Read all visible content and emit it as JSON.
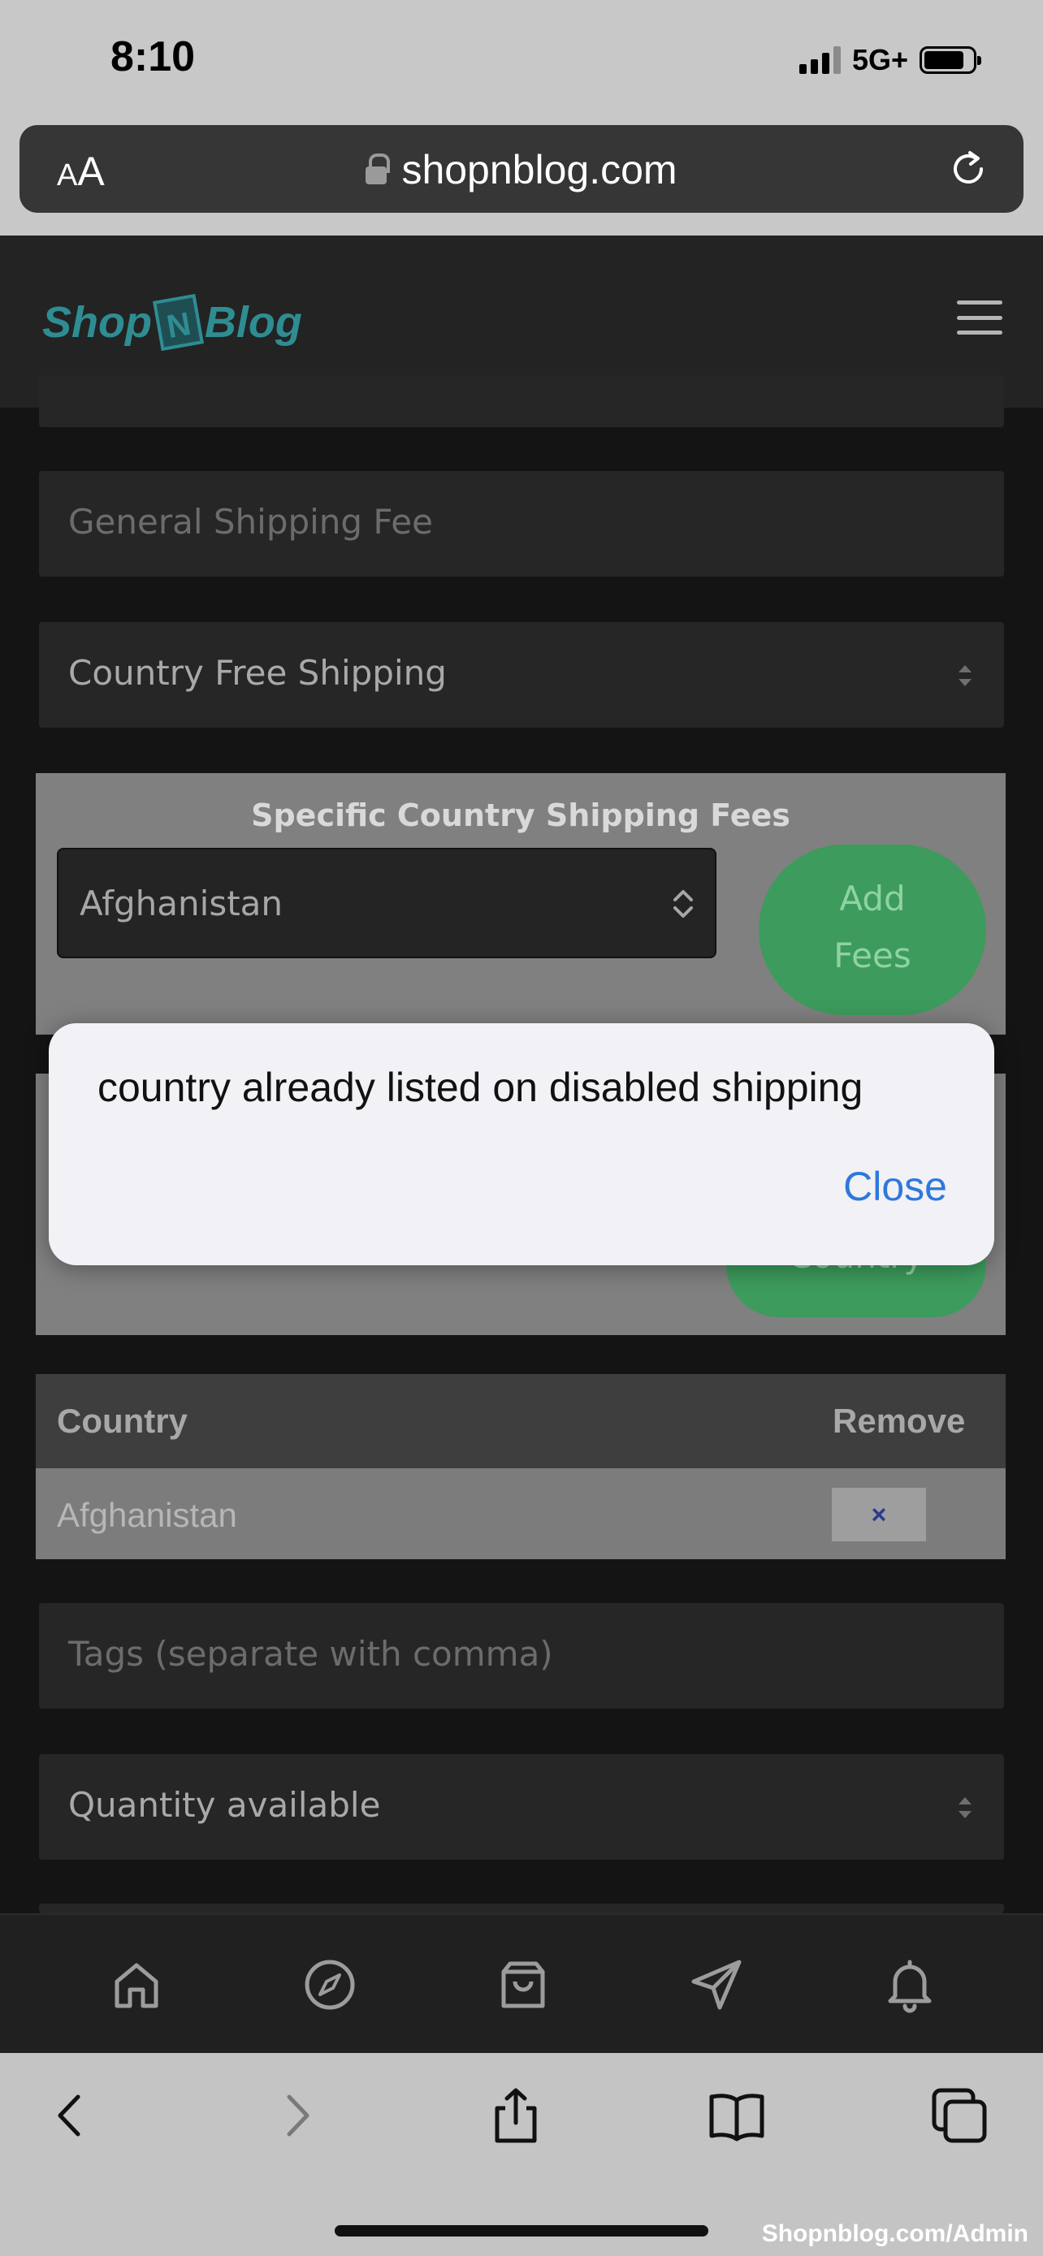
{
  "status_bar": {
    "time": "8:10",
    "network": "5G+",
    "icons": [
      "signal-icon",
      "battery-icon"
    ]
  },
  "browser": {
    "aa_label_small": "A",
    "aa_label_large": "A",
    "url": "shopnblog.com",
    "icons": [
      "lock-icon",
      "reload-icon"
    ]
  },
  "site_header": {
    "logo_left": "Shop",
    "logo_badge": "N",
    "logo_right": "Blog",
    "logo_color": "#2e8d92",
    "menu_icon": "hamburger-icon"
  },
  "form": {
    "general_shipping_fee_placeholder": "General Shipping Fee",
    "country_free_shipping_value": "Country Free Shipping",
    "specific_fees": {
      "title": "Specific Country Shipping Fees",
      "selected_country": "Afghanistan",
      "add_button_line1": "Add",
      "add_button_line2": "Fees"
    },
    "disabled_shipping": {
      "add_button_label": "Country"
    },
    "table": {
      "headers": [
        "Country",
        "Remove"
      ],
      "rows": [
        {
          "country": "Afghanistan",
          "remove": "×"
        }
      ]
    },
    "tags_placeholder": "Tags (separate with comma)",
    "quantity_value": "Quantity available"
  },
  "app_nav": {
    "items": [
      "home-icon",
      "compass-icon",
      "bag-icon",
      "send-icon",
      "bell-icon"
    ]
  },
  "browser_toolbar": {
    "items": [
      "back-icon",
      "forward-icon",
      "share-icon",
      "bookmarks-icon",
      "tabs-icon"
    ],
    "watermark": "Shopnblog.com/Admin"
  },
  "alert": {
    "message": "country already listed on disabled shipping",
    "close_label": "Close",
    "accent_color": "#2f78db"
  }
}
